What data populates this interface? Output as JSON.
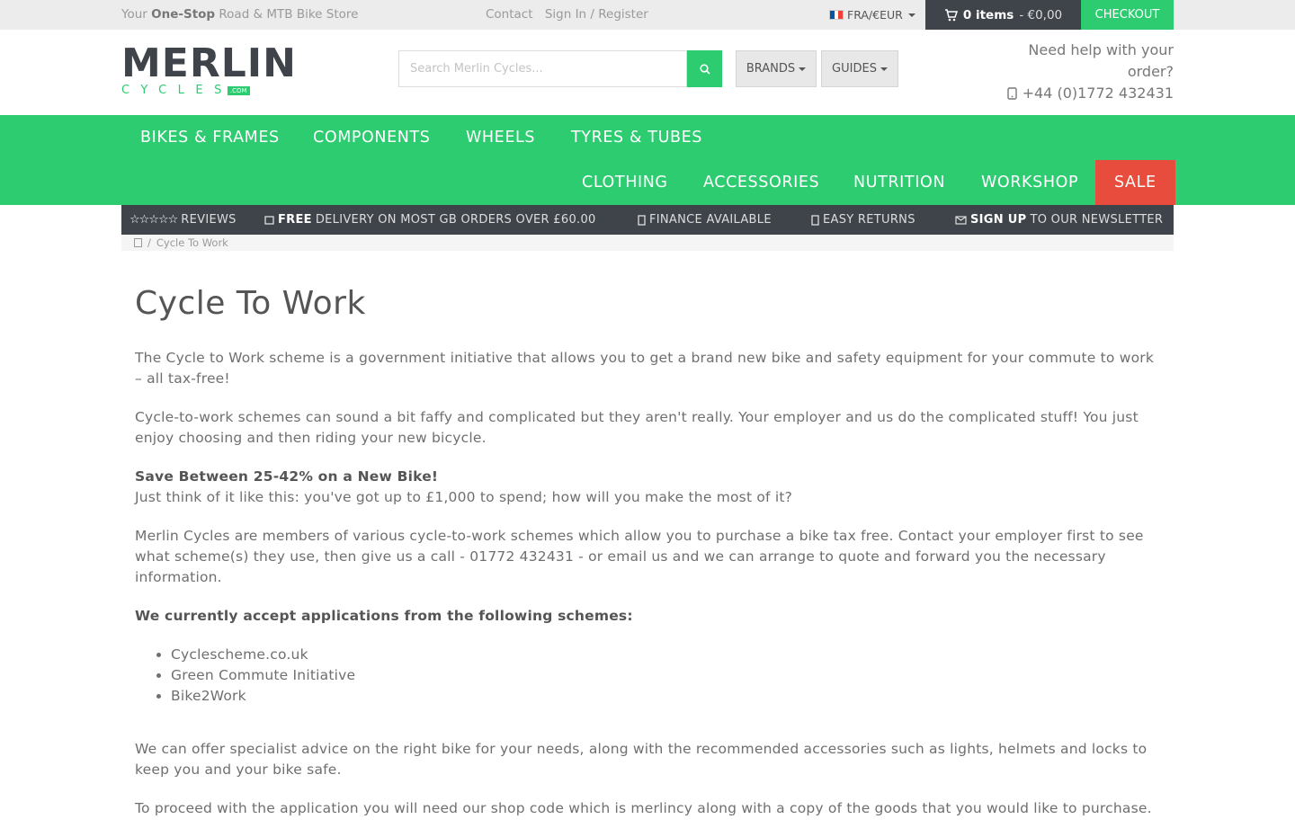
{
  "topbar": {
    "tagline_prefix": "Your ",
    "tagline_bold": "One-Stop",
    "tagline_suffix": " Road & MTB Bike Store",
    "contact": "Contact",
    "signin": "Sign In / Register",
    "currency": "FRA/€EUR",
    "cart_items": "0 items",
    "cart_total": " - €0,00",
    "checkout": "CHECKOUT"
  },
  "logo": {
    "word": "MERLIN",
    "sub": "CYCLES",
    "com": ".COM"
  },
  "search": {
    "placeholder": "Search Merlin Cycles..."
  },
  "header": {
    "brands": "BRANDS",
    "guides": "GUIDES",
    "help_line1": "Need help with your",
    "help_line2": "order?",
    "phone": "+44 (0)1772 432431"
  },
  "nav": {
    "row1": [
      "BIKES & FRAMES",
      "COMPONENTS",
      "WHEELS",
      "TYRES & TUBES"
    ],
    "row2": [
      "CLOTHING",
      "ACCESSORIES",
      "NUTRITION",
      "WORKSHOP"
    ],
    "sale": "SALE"
  },
  "usp": {
    "reviews": "REVIEWS",
    "free_bold": "FREE",
    "free_rest": " DELIVERY ON MOST GB ORDERS OVER £60.00",
    "finance": "FINANCE AVAILABLE",
    "returns": "EASY RETURNS",
    "signup_bold": "SIGN UP",
    "signup_rest": " TO OUR NEWSLETTER"
  },
  "breadcrumb": {
    "current": "Cycle To Work"
  },
  "content": {
    "title": "Cycle To Work",
    "p1": "The Cycle to Work scheme is a government initiative that allows you to get a brand new bike and safety equipment for your commute to work – all tax-free!",
    "p2": "Cycle-to-work schemes can sound a bit faffy and complicated but they aren't really. Your employer and us do the complicated stuff! You just enjoy choosing and then riding your new bicycle.",
    "save_heading": "Save Between 25-42% on a New Bike!",
    "p3": "Just think of it like this: you've got up to £1,000 to spend; how will you make the most of it?",
    "p4": "Merlin Cycles are members of various cycle-to-work schemes which allow you to purchase a bike tax free. Contact your employer first to see what scheme(s) they use, then give us a call - 01772 432431 - or email us and we can arrange to quote and forward you the necessary information.",
    "schemes_heading": "We currently accept applications from the following schemes:",
    "schemes": [
      "Cyclescheme.co.uk",
      "Green Commute Initiative",
      "Bike2Work"
    ],
    "p5": "We can offer specialist advice on the right bike for your needs, along with the recommended accessories such as lights, helmets and locks to keep you and your bike safe.",
    "p6": "To proceed with the application you will need our shop code which is merlincy along with a copy of the goods that you would like to purchase."
  },
  "colors": {
    "green": "#2ecc71",
    "dark": "#3f444b",
    "sale": "#e74c3c"
  }
}
